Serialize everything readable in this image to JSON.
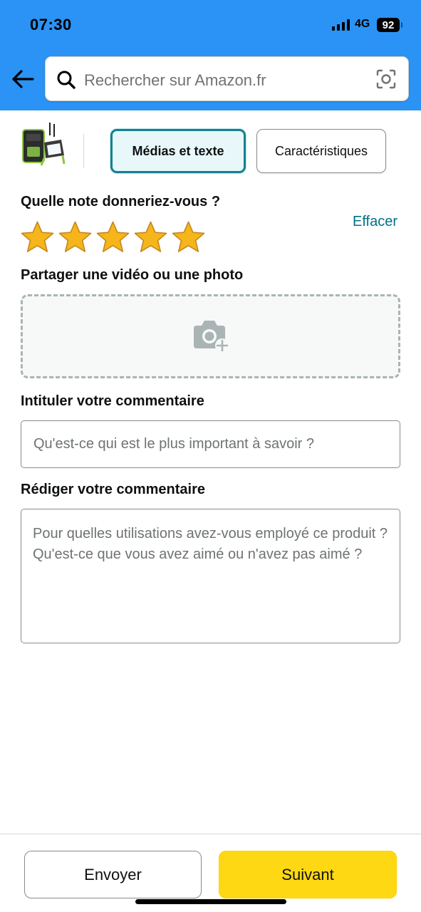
{
  "status_bar": {
    "time": "07:30",
    "network": "4G",
    "battery": "92"
  },
  "header": {
    "search_placeholder": "Rechercher sur Amazon.fr"
  },
  "tabs": {
    "media_label": "Médias et texte",
    "specs_label": "Caractéristiques"
  },
  "rating": {
    "question": "Quelle note donneriez-vous ?",
    "clear_label": "Effacer",
    "stars_filled": 5,
    "stars_total": 5,
    "star_color": "#f5b51b"
  },
  "media": {
    "title": "Partager une vidéo ou une photo"
  },
  "review_title": {
    "label": "Intituler votre commentaire",
    "placeholder": "Qu'est-ce qui est le plus important à savoir ?"
  },
  "review_body": {
    "label": "Rédiger votre commentaire",
    "placeholder": "Pour quelles utilisations avez-vous employé ce produit ? Qu'est-ce que vous avez aimé ou n'avez pas aimé ?"
  },
  "actions": {
    "send_label": "Envoyer",
    "next_label": "Suivant"
  },
  "colors": {
    "header_bg": "#2a93f5",
    "accent_teal": "#17808f",
    "link": "#007185",
    "primary_button": "#ffd814"
  }
}
